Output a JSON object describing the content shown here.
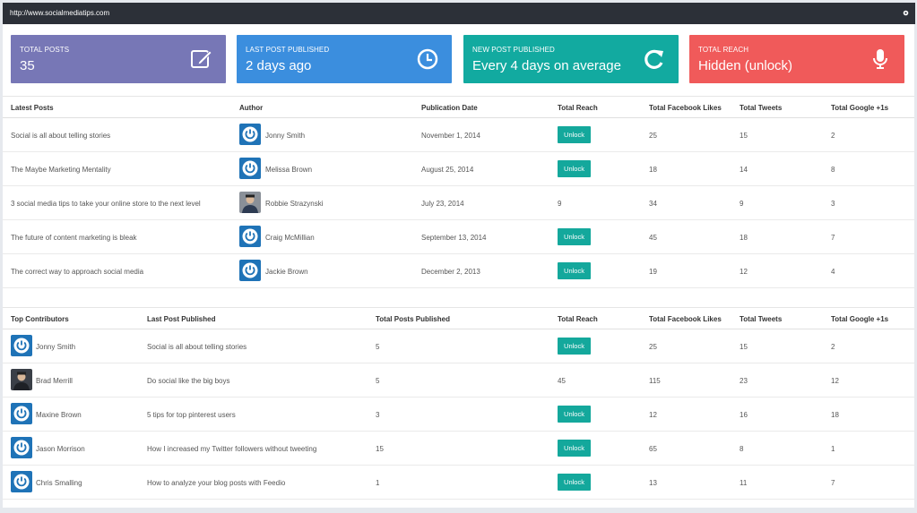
{
  "window": {
    "url": "http://www.socialmediatips.com"
  },
  "colors": {
    "card_posts": "#7777b6",
    "card_last": "#3b8ede",
    "card_new": "#12aaa0",
    "card_reach": "#f05a5a",
    "unlock_button": "#14a89c",
    "avatar_blue": "#1f73b7"
  },
  "cards": [
    {
      "label": "TOTAL POSTS",
      "value": "35",
      "icon": "edit-icon"
    },
    {
      "label": "LAST POST PUBLISHED",
      "value": "2 days ago",
      "icon": "clock-icon"
    },
    {
      "label": "NEW POST PUBLISHED",
      "value": "Every 4 days on average",
      "icon": "refresh-icon"
    },
    {
      "label": "TOTAL REACH",
      "value": "Hidden (unlock)",
      "icon": "microphone-icon"
    }
  ],
  "latest": {
    "headers": [
      "Latest Posts",
      "Author",
      "Publication Date",
      "Total Reach",
      "Total Facebook Likes",
      "Total Tweets",
      "Total Google +1s"
    ],
    "rows": [
      {
        "post": "Social is all about telling stories",
        "author": "Jonny Smith",
        "avatar": "power-icon",
        "date": "November 1, 2014",
        "reach": "Unlock",
        "locked": true,
        "likes": "25",
        "tweets": "15",
        "gplus": "2"
      },
      {
        "post": "The Maybe Marketing Mentality",
        "author": "Melissa Brown",
        "avatar": "power-icon",
        "date": "August 25, 2014",
        "reach": "Unlock",
        "locked": true,
        "likes": "18",
        "tweets": "14",
        "gplus": "8"
      },
      {
        "post": "3 social media tips to take your online store to the next level",
        "author": "Robbie Strazynski",
        "avatar": "photo",
        "date": "July 23, 2014",
        "reach": "9",
        "locked": false,
        "likes": "34",
        "tweets": "9",
        "gplus": "3"
      },
      {
        "post": "The future of content marketing is bleak",
        "author": "Craig McMillian",
        "avatar": "power-icon",
        "date": "September 13, 2014",
        "reach": "Unlock",
        "locked": true,
        "likes": "45",
        "tweets": "18",
        "gplus": "7"
      },
      {
        "post": "The correct way to approach social media",
        "author": "Jackie Brown",
        "avatar": "power-icon",
        "date": "December 2, 2013",
        "reach": "Unlock",
        "locked": true,
        "likes": "19",
        "tweets": "12",
        "gplus": "4"
      }
    ]
  },
  "contributors": {
    "headers": [
      "Top Contributors",
      "Last Post Published",
      "Total Posts Published",
      "Total Reach",
      "Total Facebook Likes",
      "Total Tweets",
      "Total Google +1s"
    ],
    "rows": [
      {
        "name": "Jonny Smith",
        "avatar": "power-icon",
        "last": "Social is all about telling stories",
        "posts": "5",
        "reach": "Unlock",
        "locked": true,
        "likes": "25",
        "tweets": "15",
        "gplus": "2"
      },
      {
        "name": "Brad Merrill",
        "avatar": "photo",
        "last": "Do social like the big boys",
        "posts": "5",
        "reach": "45",
        "locked": false,
        "likes": "115",
        "tweets": "23",
        "gplus": "12"
      },
      {
        "name": "Maxine Brown",
        "avatar": "power-icon",
        "last": "5 tips for top pinterest users",
        "posts": "3",
        "reach": "Unlock",
        "locked": true,
        "likes": "12",
        "tweets": "16",
        "gplus": "18"
      },
      {
        "name": "Jason Morrison",
        "avatar": "power-icon",
        "last": "How I increased my Twitter followers without tweeting",
        "posts": "15",
        "reach": "Unlock",
        "locked": true,
        "likes": "65",
        "tweets": "8",
        "gplus": "1"
      },
      {
        "name": "Chris Smalling",
        "avatar": "power-icon",
        "last": "How to analyze your blog posts with Feedio",
        "posts": "1",
        "reach": "Unlock",
        "locked": true,
        "likes": "13",
        "tweets": "11",
        "gplus": "7"
      }
    ]
  }
}
